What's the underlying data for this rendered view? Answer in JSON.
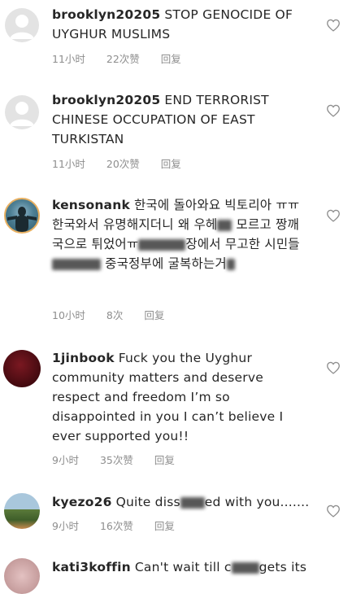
{
  "comments": [
    {
      "username": "brooklyn20205",
      "text": "STOP GENOCIDE OF UYGHUR MUSLIMS",
      "time": "11小时",
      "likes": "22次赞",
      "reply": "回复",
      "avatar_icon": "default-avatar-icon"
    },
    {
      "username": "brooklyn20205",
      "text": "END TERRORIST CHINESE OCCUPATION OF EAST TURKISTAN",
      "time": "11小时",
      "likes": "20次赞",
      "reply": "回复",
      "avatar_icon": "default-avatar-icon"
    },
    {
      "username": "kensonank",
      "text_parts": [
        "한국에 돌아와요 빅토리아 ㅠㅠ한국와서 유명해지더니 왜 우헤",
        "모르고 짱깨국으로 튀었어ㅠ",
        "장에서 무고한 시민들",
        "중국정부에 굴복하는거"
      ],
      "time": "10小时",
      "likes": "8次",
      "reply": "回复",
      "avatar_icon": "profile-photo-icon"
    },
    {
      "username": "1jinbook",
      "text": "Fuck you the Uyghur community  matters and deserve respect and freedom I’m so disappointed in you I can’t believe I ever supported you!!",
      "time": "9小时",
      "likes": "35次赞",
      "reply": "回复",
      "avatar_icon": "profile-photo-icon"
    },
    {
      "username": "kyezo26",
      "text_parts": [
        "Quite diss",
        "ed with you......."
      ],
      "time": "9小时",
      "likes": "16次赞",
      "reply": "回复",
      "avatar_icon": "profile-photo-icon"
    },
    {
      "username": "kati3koffin",
      "text_parts": [
        "Can't wait till c",
        "gets its"
      ],
      "avatar_icon": "profile-photo-icon"
    }
  ],
  "icons": {
    "like": "heart-outline-icon"
  },
  "colors": {
    "text": "#262626",
    "meta": "#8e8e8e",
    "heart": "#8e8e8e"
  }
}
